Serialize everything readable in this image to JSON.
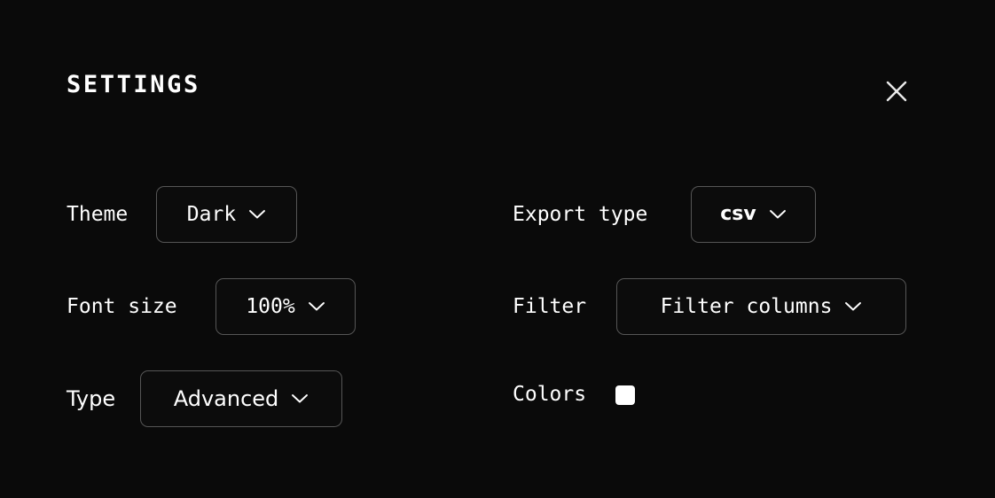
{
  "header": {
    "title": "SETTINGS",
    "close_icon": "close-x-icon"
  },
  "settings": {
    "left_column": [
      {
        "id": "theme",
        "label": "Theme",
        "control": "dropdown",
        "value": "Dark",
        "icon": "chevron-down-icon"
      },
      {
        "id": "font_size",
        "label": "Font size",
        "control": "dropdown",
        "value": "100%",
        "icon": "chevron-down-icon"
      },
      {
        "id": "type",
        "label": "Type",
        "control": "dropdown",
        "value": "Advanced",
        "icon": "chevron-down-icon"
      }
    ],
    "right_column": [
      {
        "id": "export_type",
        "label": "Export type",
        "control": "dropdown",
        "value": "csv",
        "icon": "chevron-down-icon"
      },
      {
        "id": "filter",
        "label": "Filter",
        "control": "dropdown",
        "value": "Filter columns",
        "icon": "chevron-down-icon"
      },
      {
        "id": "colors",
        "label": "Colors",
        "control": "color-swatch",
        "value": "#ffffff"
      }
    ]
  },
  "colors": {
    "background": "#0a0a0a",
    "text": "#ffffff",
    "border": "#565656",
    "control_background": "#0c0c0c",
    "swatch": "#ffffff"
  }
}
